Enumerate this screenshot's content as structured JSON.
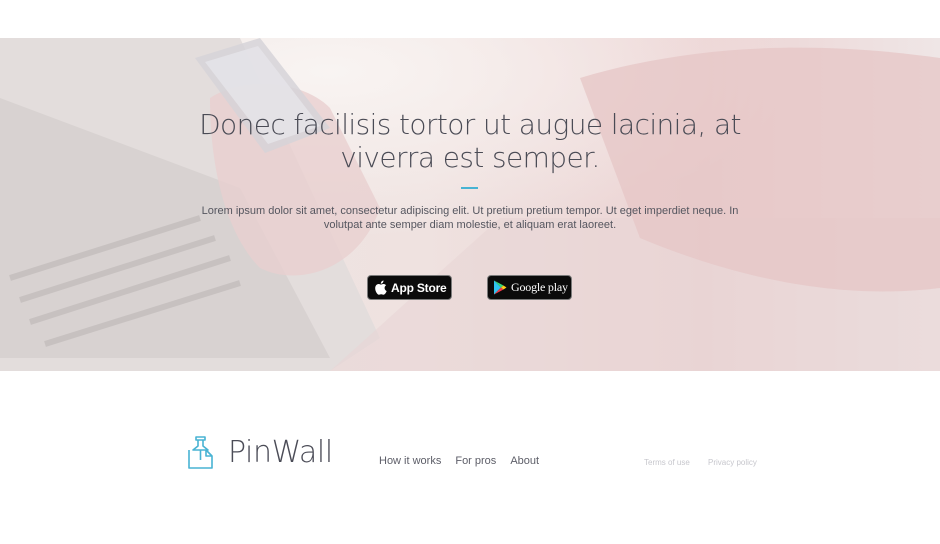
{
  "hero": {
    "title": "Donec facilisis tortor ut augue lacinia, at viverra est semper.",
    "description": "Lorem ipsum dolor sit amet, consectetur adipiscing elit. Ut pretium pretium tempor. Ut eget imperdiet neque. In volutpat ante semper diam molestie, et aliquam erat laoreet.",
    "accent_color": "#48b3d3",
    "background_image": "person-holding-phone-at-laptop"
  },
  "store_buttons": {
    "app_store_label": "App Store",
    "app_store_icon": "apple-icon",
    "google_play_label": "Google play",
    "google_play_icon": "google-play-icon"
  },
  "footer": {
    "brand": "PinWall",
    "logo_icon": "pin-icon",
    "logo_color": "#48b3d3",
    "nav": [
      "How it works",
      "For pros",
      "About"
    ],
    "legal": [
      "Terms of use",
      "Privacy policy"
    ]
  }
}
